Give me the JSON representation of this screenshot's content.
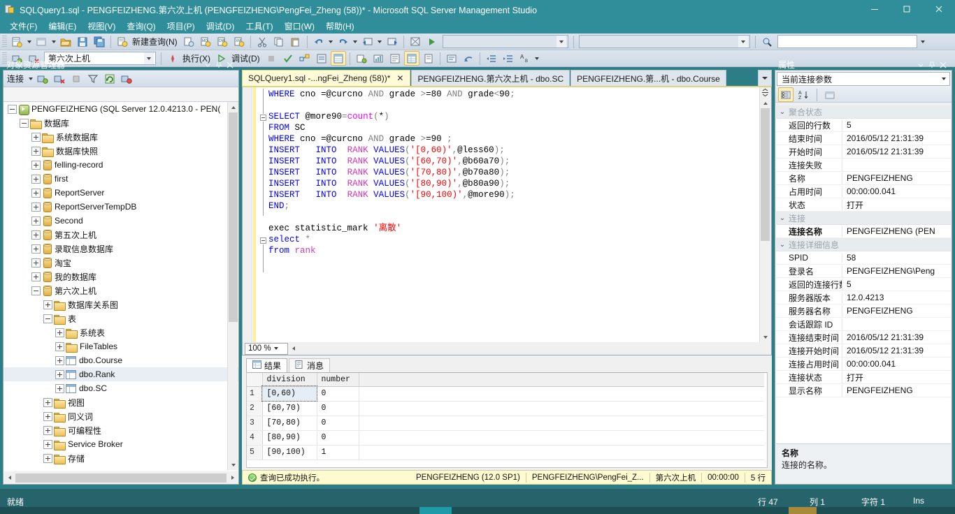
{
  "window": {
    "title": "SQLQuery1.sql - PENGFEIZHENG.第六次上机 (PENGFEIZHENG\\PengFei_Zheng (58))* - Microsoft SQL Server Management Studio",
    "minimize": "—",
    "maximize": "❐",
    "close": "✕"
  },
  "menu": {
    "items": [
      {
        "label": "文件(F)"
      },
      {
        "label": "编辑(E)"
      },
      {
        "label": "视图(V)"
      },
      {
        "label": "查询(Q)"
      },
      {
        "label": "项目(P)"
      },
      {
        "label": "调试(D)"
      },
      {
        "label": "工具(T)"
      },
      {
        "label": "窗口(W)"
      },
      {
        "label": "帮助(H)"
      }
    ]
  },
  "toolbar": {
    "new_query_label": "新建查询(N)",
    "database_combo": "第六次上机",
    "execute_label": "执行(X)",
    "debug_label": "调试(D)",
    "empty_combo_1": "",
    "empty_combo_2": "",
    "search_box": ""
  },
  "object_explorer": {
    "title": "对象资源管理器",
    "connect_label": "连接",
    "tree": [
      {
        "indent": 0,
        "expander": "minus",
        "icon": "server-icon",
        "label": "PENGFEIZHENG (SQL Server 12.0.4213.0 - PEN("
      },
      {
        "indent": 1,
        "expander": "minus",
        "icon": "folder-icon",
        "label": "数据库"
      },
      {
        "indent": 2,
        "expander": "plus",
        "icon": "folder-icon",
        "label": "系统数据库"
      },
      {
        "indent": 2,
        "expander": "plus",
        "icon": "folder-icon",
        "label": "数据库快照"
      },
      {
        "indent": 2,
        "expander": "plus",
        "icon": "database-icon",
        "label": "felling-record"
      },
      {
        "indent": 2,
        "expander": "plus",
        "icon": "database-icon",
        "label": "first"
      },
      {
        "indent": 2,
        "expander": "plus",
        "icon": "database-icon",
        "label": "ReportServer"
      },
      {
        "indent": 2,
        "expander": "plus",
        "icon": "database-icon",
        "label": "ReportServerTempDB"
      },
      {
        "indent": 2,
        "expander": "plus",
        "icon": "database-icon",
        "label": "Second"
      },
      {
        "indent": 2,
        "expander": "plus",
        "icon": "database-icon",
        "label": "第五次上机"
      },
      {
        "indent": 2,
        "expander": "plus",
        "icon": "database-icon",
        "label": "录取信息数据库"
      },
      {
        "indent": 2,
        "expander": "plus",
        "icon": "database-icon",
        "label": "淘宝"
      },
      {
        "indent": 2,
        "expander": "plus",
        "icon": "database-icon",
        "label": "我的数据库"
      },
      {
        "indent": 2,
        "expander": "minus",
        "icon": "database-icon",
        "label": "第六次上机"
      },
      {
        "indent": 3,
        "expander": "plus",
        "icon": "folder-icon",
        "label": "数据库关系图"
      },
      {
        "indent": 3,
        "expander": "minus",
        "icon": "folder-icon",
        "label": "表"
      },
      {
        "indent": 4,
        "expander": "plus",
        "icon": "folder-icon",
        "label": "系统表"
      },
      {
        "indent": 4,
        "expander": "plus",
        "icon": "folder-icon",
        "label": "FileTables"
      },
      {
        "indent": 4,
        "expander": "plus",
        "icon": "table-icon",
        "label": "dbo.Course"
      },
      {
        "indent": 4,
        "expander": "plus",
        "icon": "table-icon",
        "label": "dbo.Rank",
        "selected": true
      },
      {
        "indent": 4,
        "expander": "plus",
        "icon": "table-icon",
        "label": "dbo.SC"
      },
      {
        "indent": 3,
        "expander": "plus",
        "icon": "folder-icon",
        "label": "视图"
      },
      {
        "indent": 3,
        "expander": "plus",
        "icon": "folder-icon",
        "label": "同义词"
      },
      {
        "indent": 3,
        "expander": "plus",
        "icon": "folder-icon",
        "label": "可编程性"
      },
      {
        "indent": 3,
        "expander": "plus",
        "icon": "folder-icon",
        "label": "Service Broker"
      },
      {
        "indent": 3,
        "expander": "plus",
        "icon": "folder-icon",
        "label": "存储"
      }
    ]
  },
  "document": {
    "tabs": [
      {
        "label": "SQLQuery1.sql -...ngFei_Zheng (58))*",
        "active": true,
        "closable": true
      },
      {
        "label": "PENGFEIZHENG.第六次上机 - dbo.SC",
        "active": false,
        "closable": false
      },
      {
        "label": "PENGFEIZHENG.第...机 - dbo.Course",
        "active": false,
        "closable": false
      }
    ],
    "zoom": "100 %"
  },
  "editor": {
    "lines": [
      [
        {
          "t": "  ",
          "c": ""
        },
        {
          "t": "WHERE",
          "c": "k"
        },
        {
          "t": " cno =@curcno ",
          "c": ""
        },
        {
          "t": "AND",
          "c": "kg"
        },
        {
          "t": " grade ",
          "c": ""
        },
        {
          "t": ">",
          "c": "kg"
        },
        {
          "t": "=80 ",
          "c": ""
        },
        {
          "t": "AND",
          "c": "kg"
        },
        {
          "t": " grade",
          "c": ""
        },
        {
          "t": "<",
          "c": "kg"
        },
        {
          "t": "90",
          "c": ""
        },
        {
          "t": ";",
          "c": "kg"
        }
      ],
      [],
      [
        {
          "t": "  ",
          "c": ""
        },
        {
          "t": "SELECT",
          "c": "k"
        },
        {
          "t": " @more90",
          "c": ""
        },
        {
          "t": "=",
          "c": "kg"
        },
        {
          "t": "count",
          "c": "fn"
        },
        {
          "t": "(",
          "c": "kg"
        },
        {
          "t": "*",
          "c": ""
        },
        {
          "t": ")",
          "c": "kg"
        }
      ],
      [
        {
          "t": "  ",
          "c": ""
        },
        {
          "t": "FROM",
          "c": "k"
        },
        {
          "t": " SC",
          "c": ""
        }
      ],
      [
        {
          "t": "  ",
          "c": ""
        },
        {
          "t": "WHERE",
          "c": "k"
        },
        {
          "t": " cno =@curcno ",
          "c": ""
        },
        {
          "t": "AND",
          "c": "kg"
        },
        {
          "t": " grade ",
          "c": ""
        },
        {
          "t": ">",
          "c": "kg"
        },
        {
          "t": "=90 ",
          "c": ""
        },
        {
          "t": ";",
          "c": "kg"
        }
      ],
      [
        {
          "t": "  ",
          "c": ""
        },
        {
          "t": "INSERT",
          "c": "k"
        },
        {
          "t": "   ",
          "c": ""
        },
        {
          "t": "INTO",
          "c": "k"
        },
        {
          "t": "  ",
          "c": ""
        },
        {
          "t": "RANK",
          "c": "tbl"
        },
        {
          "t": " ",
          "c": ""
        },
        {
          "t": "VALUES",
          "c": "k"
        },
        {
          "t": "(",
          "c": "kg"
        },
        {
          "t": "'[0,60)'",
          "c": "str"
        },
        {
          "t": ",",
          "c": "kg"
        },
        {
          "t": "@less60",
          "c": ""
        },
        {
          "t": ");",
          "c": "kg"
        }
      ],
      [
        {
          "t": "  ",
          "c": ""
        },
        {
          "t": "INSERT",
          "c": "k"
        },
        {
          "t": "   ",
          "c": ""
        },
        {
          "t": "INTO",
          "c": "k"
        },
        {
          "t": "  ",
          "c": ""
        },
        {
          "t": "RANK",
          "c": "tbl"
        },
        {
          "t": " ",
          "c": ""
        },
        {
          "t": "VALUES",
          "c": "k"
        },
        {
          "t": "(",
          "c": "kg"
        },
        {
          "t": "'[60,70)'",
          "c": "str"
        },
        {
          "t": ",",
          "c": "kg"
        },
        {
          "t": "@b60a70",
          "c": ""
        },
        {
          "t": ");",
          "c": "kg"
        }
      ],
      [
        {
          "t": "  ",
          "c": ""
        },
        {
          "t": "INSERT",
          "c": "k"
        },
        {
          "t": "   ",
          "c": ""
        },
        {
          "t": "INTO",
          "c": "k"
        },
        {
          "t": "  ",
          "c": ""
        },
        {
          "t": "RANK",
          "c": "tbl"
        },
        {
          "t": " ",
          "c": ""
        },
        {
          "t": "VALUES",
          "c": "k"
        },
        {
          "t": "(",
          "c": "kg"
        },
        {
          "t": "'[70,80)'",
          "c": "str"
        },
        {
          "t": ",",
          "c": "kg"
        },
        {
          "t": "@b70a80",
          "c": ""
        },
        {
          "t": ");",
          "c": "kg"
        }
      ],
      [
        {
          "t": "  ",
          "c": ""
        },
        {
          "t": "INSERT",
          "c": "k"
        },
        {
          "t": "   ",
          "c": ""
        },
        {
          "t": "INTO",
          "c": "k"
        },
        {
          "t": "  ",
          "c": ""
        },
        {
          "t": "RANK",
          "c": "tbl"
        },
        {
          "t": " ",
          "c": ""
        },
        {
          "t": "VALUES",
          "c": "k"
        },
        {
          "t": "(",
          "c": "kg"
        },
        {
          "t": "'[80,90)'",
          "c": "str"
        },
        {
          "t": ",",
          "c": "kg"
        },
        {
          "t": "@b80a90",
          "c": ""
        },
        {
          "t": ");",
          "c": "kg"
        }
      ],
      [
        {
          "t": "  ",
          "c": ""
        },
        {
          "t": "INSERT",
          "c": "k"
        },
        {
          "t": "   ",
          "c": ""
        },
        {
          "t": "INTO",
          "c": "k"
        },
        {
          "t": "  ",
          "c": ""
        },
        {
          "t": "RANK",
          "c": "tbl"
        },
        {
          "t": " ",
          "c": ""
        },
        {
          "t": "VALUES",
          "c": "k"
        },
        {
          "t": "(",
          "c": "kg"
        },
        {
          "t": "'[90,100)'",
          "c": "str"
        },
        {
          "t": ",",
          "c": "kg"
        },
        {
          "t": "@more90",
          "c": ""
        },
        {
          "t": ");",
          "c": "kg"
        }
      ],
      [
        {
          "t": "  ",
          "c": ""
        },
        {
          "t": "END",
          "c": "k"
        },
        {
          "t": ";",
          "c": "kg"
        }
      ],
      [],
      [
        {
          "t": "  ",
          "c": ""
        },
        {
          "t": "exec",
          "c": ""
        },
        {
          "t": " statistic_mark ",
          "c": ""
        },
        {
          "t": "'离散'",
          "c": "str"
        }
      ],
      [
        {
          "t": "  ",
          "c": ""
        },
        {
          "t": "select",
          "c": "k"
        },
        {
          "t": " ",
          "c": ""
        },
        {
          "t": "*",
          "c": "kg"
        }
      ],
      [
        {
          "t": "  ",
          "c": ""
        },
        {
          "t": "from",
          "c": "k"
        },
        {
          "t": " ",
          "c": ""
        },
        {
          "t": "rank",
          "c": "tbl"
        }
      ]
    ]
  },
  "results": {
    "tabs": [
      {
        "label": "结果",
        "icon": "grid-icon",
        "active": true
      },
      {
        "label": "消息",
        "icon": "message-icon",
        "active": false
      }
    ],
    "columns": [
      "",
      "division",
      "number"
    ],
    "rows": [
      {
        "num": "1",
        "division": "[0,60)",
        "number": "0",
        "selected": true
      },
      {
        "num": "2",
        "division": "[60,70)",
        "number": "0",
        "selected": false
      },
      {
        "num": "3",
        "division": "[70,80)",
        "number": "0",
        "selected": false
      },
      {
        "num": "4",
        "division": "[80,90)",
        "number": "0",
        "selected": false
      },
      {
        "num": "5",
        "division": "[90,100)",
        "number": "1",
        "selected": false
      }
    ],
    "status": {
      "message": "查询已成功执行。",
      "server": "PENGFEIZHENG (12.0 SP1)",
      "user": "PENGFEIZHENG\\PengFei_Z...",
      "database": "第六次上机",
      "duration": "00:00:00",
      "rowcount": "5 行"
    }
  },
  "properties": {
    "title": "属性",
    "selector": "当前连接参数",
    "groups": [
      {
        "name": "聚合状态",
        "rows": [
          {
            "name": "返回的行数",
            "value": "5"
          },
          {
            "name": "结束时间",
            "value": "2016/05/12 21:31:39"
          },
          {
            "name": "开始时间",
            "value": "2016/05/12 21:31:39"
          },
          {
            "name": "连接失败",
            "value": ""
          },
          {
            "name": "名称",
            "value": "PENGFEIZHENG"
          },
          {
            "name": "占用时间",
            "value": "00:00:00.041"
          },
          {
            "name": "状态",
            "value": "打开"
          }
        ]
      },
      {
        "name": "连接",
        "rows": [
          {
            "name": "连接名称",
            "value": "PENGFEIZHENG (PEN",
            "selected": true
          }
        ]
      },
      {
        "name": "连接详细信息",
        "rows": [
          {
            "name": "SPID",
            "value": "58"
          },
          {
            "name": "登录名",
            "value": "PENGFEIZHENG\\Peng"
          },
          {
            "name": "返回的连接行数",
            "value": "5"
          },
          {
            "name": "服务器版本",
            "value": "12.0.4213"
          },
          {
            "name": "服务器名称",
            "value": "PENGFEIZHENG"
          },
          {
            "name": "会话跟踪 ID",
            "value": ""
          },
          {
            "name": "连接结束时间",
            "value": "2016/05/12 21:31:39"
          },
          {
            "name": "连接开始时间",
            "value": "2016/05/12 21:31:39"
          },
          {
            "name": "连接占用时间",
            "value": "00:00:00.041"
          },
          {
            "name": "连接状态",
            "value": "打开"
          },
          {
            "name": "显示名称",
            "value": "PENGFEIZHENG"
          }
        ]
      }
    ],
    "description": {
      "title": "名称",
      "body": "连接的名称。"
    }
  },
  "statusbar": {
    "state": "就绪",
    "line": "行 47",
    "column": "列 1",
    "char": "字符 1",
    "insert": "Ins"
  },
  "colors": {
    "chrome": "#2f8e99",
    "chrome_dark": "#27636b",
    "active_tab": "#fffbd8",
    "status_strip": "#fdfbcf",
    "accent_blue": "#0000ff",
    "accent_magenta": "#ff00ff",
    "accent_red": "#ff0000"
  }
}
